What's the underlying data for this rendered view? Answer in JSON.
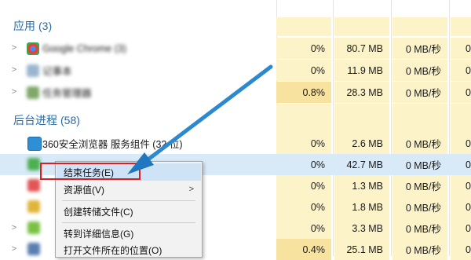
{
  "groups": {
    "apps": {
      "title": "应用",
      "count": "(3)"
    },
    "background": {
      "title": "后台进程",
      "count": "(58)"
    }
  },
  "app_rows": [
    {
      "name": "Google Chrome (3)",
      "cpu": "0%",
      "memory": "80.7 MB",
      "disk": "0 MB/秒",
      "network": "0"
    },
    {
      "name": "记事本",
      "cpu": "0%",
      "memory": "11.9 MB",
      "disk": "0 MB/秒",
      "network": "0"
    },
    {
      "name": "任务管理器",
      "cpu": "0.8%",
      "memory": "28.3 MB",
      "disk": "0 MB/秒",
      "network": "0"
    }
  ],
  "bg_rows": [
    {
      "name": "360安全浏览器 服务组件 (32 位)",
      "cpu": "0%",
      "memory": "2.6 MB",
      "disk": "0 MB/秒",
      "network": "0"
    },
    {
      "name": "",
      "cpu": "0%",
      "memory": "42.7 MB",
      "disk": "0 MB/秒",
      "network": "0"
    },
    {
      "name": "",
      "cpu": "0%",
      "memory": "1.3 MB",
      "disk": "0 MB/秒",
      "network": "0"
    },
    {
      "name": "",
      "cpu": "0%",
      "memory": "1.8 MB",
      "disk": "0 MB/秒",
      "network": "0"
    },
    {
      "name": "",
      "cpu": "0%",
      "memory": "3.3 MB",
      "disk": "0 MB/秒",
      "network": "0"
    },
    {
      "name": "",
      "cpu": "0.4%",
      "memory": "25.1 MB",
      "disk": "0 MB/秒",
      "network": "0"
    }
  ],
  "context_menu": {
    "items": [
      {
        "label": "结束任务(E)"
      },
      {
        "label": "资源值(V)"
      },
      {
        "label": "创建转储文件(C)"
      },
      {
        "label": "转到详细信息(G)"
      },
      {
        "label": "打开文件所在的位置(O)"
      }
    ]
  },
  "colors": {
    "group_title": "#2a6aa8",
    "heat_light": "#fdf3c8",
    "heat_medium": "#f7e2a0",
    "selection": "#d8e9f8",
    "annotation": "#d81f26",
    "arrow": "#2d8bcf"
  }
}
